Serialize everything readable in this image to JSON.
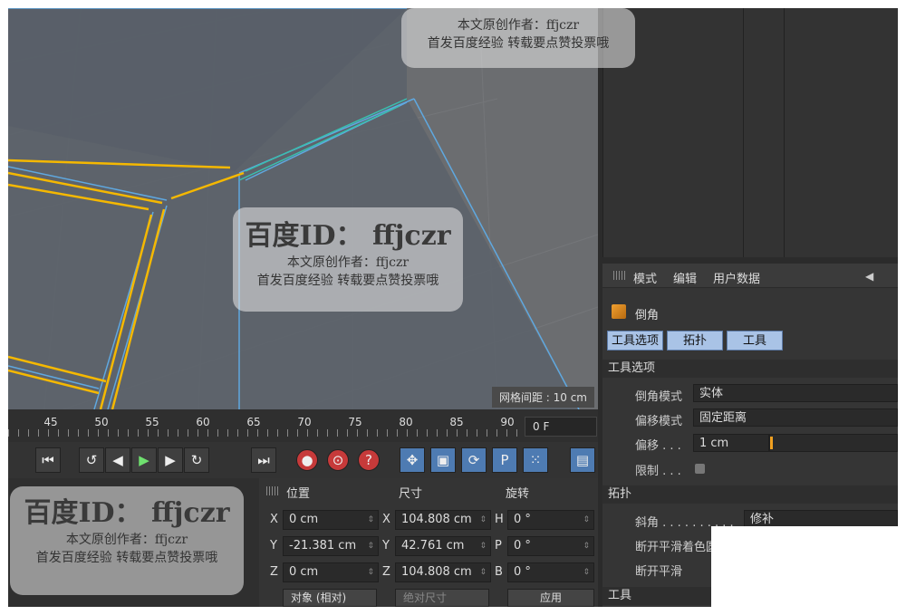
{
  "viewport": {
    "grid_label": "网格间距 : 10 cm"
  },
  "timeline": {
    "ticks": [
      "45",
      "50",
      "55",
      "60",
      "65",
      "70",
      "75",
      "80",
      "85",
      "90"
    ],
    "frame_value": "0 F"
  },
  "attributes": {
    "menu": [
      "模式",
      "编辑",
      "用户数据"
    ],
    "object_name": "倒角",
    "tabs": [
      "工具选项",
      "拓扑",
      "工具"
    ],
    "section_tool_options": "工具选项",
    "bevel_mode_label": "倒角模式",
    "bevel_mode_value": "实体",
    "offset_mode_label": "偏移模式",
    "offset_mode_value": "固定距离",
    "offset_label": "偏移 . . .",
    "offset_value": "1 cm",
    "limit_label": "限制 . . .",
    "section_topology": "拓扑",
    "miter_label": "斜角 . . . . . . . . . .",
    "miter_value": "修补",
    "break_phong_label": "断开平滑着色圆角",
    "break_phong2_label": "断开平滑",
    "section_tool": "工具"
  },
  "coords": {
    "headers": {
      "position": "位置",
      "size": "尺寸",
      "rotation": "旋转"
    },
    "rows": [
      {
        "pl": "X",
        "pv": "0 cm",
        "sl": "X",
        "sv": "104.808 cm",
        "rl": "H",
        "rv": "0 °"
      },
      {
        "pl": "Y",
        "pv": "-21.381 cm",
        "sl": "Y",
        "sv": "42.761 cm",
        "rl": "P",
        "rv": "0 °"
      },
      {
        "pl": "Z",
        "pv": "0 cm",
        "sl": "Z",
        "sv": "104.808 cm",
        "rl": "B",
        "rv": "0 °"
      }
    ],
    "mode_dropdown": "对象 (相对)",
    "size_dropdown": "绝对尺寸",
    "apply_button": "应用"
  },
  "watermark": {
    "line1": "百度ID： ffjczr",
    "line2": "本文原创作者：ffjczr",
    "line3": "首发百度经验 转载要点赞投票哦",
    "top_line2": "本文原创作者：ffjczr",
    "top_line3": "首发百度经验 转载要点赞投票哦"
  },
  "colors": {
    "viewport_bg": "#6b6d70",
    "selected_edge": "#f5b800",
    "edge_blue": "#5fa8e0",
    "tab_blue": "#a9c3e6"
  }
}
